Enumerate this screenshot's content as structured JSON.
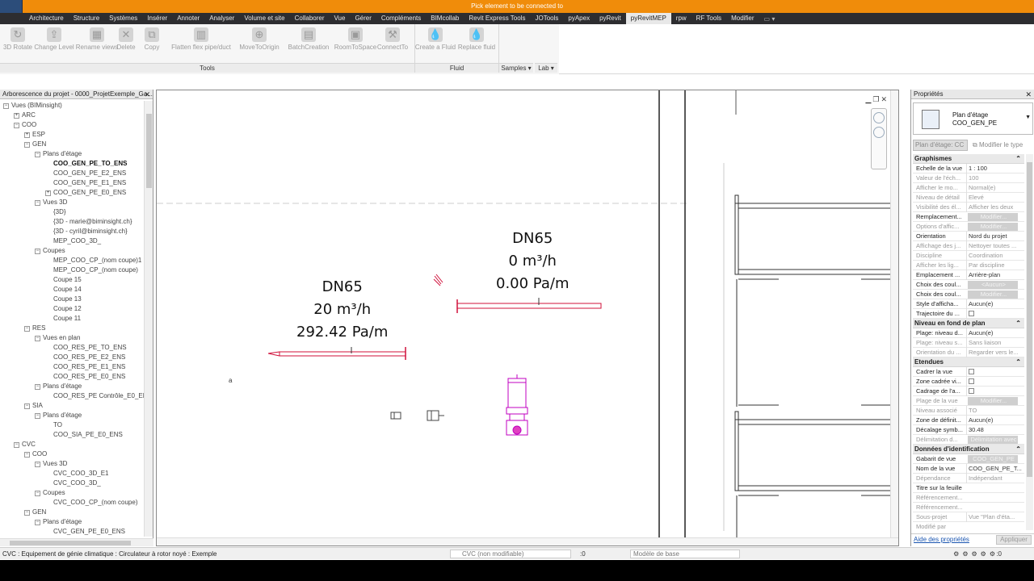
{
  "title": "Pick element to be connected to",
  "ribbon_tabs": [
    "Architecture",
    "Structure",
    "Systèmes",
    "Insérer",
    "Annoter",
    "Analyser",
    "Volume et site",
    "Collaborer",
    "Vue",
    "Gérer",
    "Compléments",
    "BIMcollab",
    "Revit Express Tools",
    "JOTools",
    "pyApex",
    "pyRevit",
    "pyRevitMEP",
    "rpw",
    "RF Tools",
    "Modifier"
  ],
  "active_tab": "pyRevitMEP",
  "ribbon_buttons": [
    {
      "label": "3D Rotate",
      "icon": "rotate-icon"
    },
    {
      "label": "Change Level",
      "icon": "level-icon"
    },
    {
      "label": "Rename views",
      "icon": "rename-icon"
    },
    {
      "label": "Delete",
      "icon": "delete-icon"
    },
    {
      "label": "Copy",
      "icon": "copy-icon"
    },
    {
      "label": "Flatten flex pipe/duct",
      "icon": "flatten-icon"
    },
    {
      "label": "MoveToOrigin",
      "icon": "target-icon"
    },
    {
      "label": "BatchCreation",
      "icon": "batch-icon"
    },
    {
      "label": "RoomToSpace",
      "icon": "room-icon"
    },
    {
      "label": "ConnectTo",
      "icon": "connect-icon"
    },
    {
      "label": "Create a Fluid",
      "icon": "drop-icon"
    },
    {
      "label": "Replace fluid",
      "icon": "drop-icon"
    }
  ],
  "ribbon_panels": {
    "tools": "Tools",
    "fluid": "Fluid",
    "samples": "Samples",
    "lab": "Lab"
  },
  "browser": {
    "title": "Arborescence du projet - 0000_ProjetExemple_Ga...",
    "nodes": [
      {
        "label": "Vues (BIMinsight)",
        "toggle": "−",
        "level": 0
      },
      {
        "label": "ARC",
        "toggle": "+",
        "level": 1
      },
      {
        "label": "COO",
        "toggle": "−",
        "level": 1
      },
      {
        "label": "ESP",
        "toggle": "+",
        "level": 2
      },
      {
        "label": "GEN",
        "toggle": "−",
        "level": 2
      },
      {
        "label": "Plans d'étage",
        "toggle": "−",
        "level": 3
      },
      {
        "label": "COO_GEN_PE_TO_ENS",
        "toggle": "",
        "level": 4,
        "bold": true
      },
      {
        "label": "COO_GEN_PE_E2_ENS",
        "toggle": "",
        "level": 4
      },
      {
        "label": "COO_GEN_PE_E1_ENS",
        "toggle": "",
        "level": 4
      },
      {
        "label": "COO_GEN_PE_E0_ENS",
        "toggle": "+",
        "level": 4
      },
      {
        "label": "Vues 3D",
        "toggle": "−",
        "level": 3
      },
      {
        "label": "{3D}",
        "toggle": "",
        "level": 4
      },
      {
        "label": "{3D - marie@biminsight.ch}",
        "toggle": "",
        "level": 4
      },
      {
        "label": "{3D - cyril@biminsight.ch}",
        "toggle": "",
        "level": 4
      },
      {
        "label": "MEP_COO_3D_",
        "toggle": "",
        "level": 4
      },
      {
        "label": "Coupes",
        "toggle": "−",
        "level": 3
      },
      {
        "label": "MEP_COO_CP_(nom coupe)1",
        "toggle": "",
        "level": 4
      },
      {
        "label": "MEP_COO_CP_(nom coupe)",
        "toggle": "",
        "level": 4
      },
      {
        "label": "Coupe 15",
        "toggle": "",
        "level": 4
      },
      {
        "label": "Coupe 14",
        "toggle": "",
        "level": 4
      },
      {
        "label": "Coupe 13",
        "toggle": "",
        "level": 4
      },
      {
        "label": "Coupe 12",
        "toggle": "",
        "level": 4
      },
      {
        "label": "Coupe 11",
        "toggle": "",
        "level": 4
      },
      {
        "label": "RES",
        "toggle": "−",
        "level": 2
      },
      {
        "label": "Vues en plan",
        "toggle": "−",
        "level": 3
      },
      {
        "label": "COO_RES_PE_TO_ENS",
        "toggle": "",
        "level": 4
      },
      {
        "label": "COO_RES_PE_E2_ENS",
        "toggle": "",
        "level": 4
      },
      {
        "label": "COO_RES_PE_E1_ENS",
        "toggle": "",
        "level": 4
      },
      {
        "label": "COO_RES_PE_E0_ENS",
        "toggle": "",
        "level": 4
      },
      {
        "label": "Plans d'étage",
        "toggle": "−",
        "level": 3
      },
      {
        "label": "COO_RES_PE Contrôle_E0_EN",
        "toggle": "",
        "level": 4
      },
      {
        "label": "SIA",
        "toggle": "−",
        "level": 2
      },
      {
        "label": "Plans d'étage",
        "toggle": "−",
        "level": 3
      },
      {
        "label": "TO",
        "toggle": "",
        "level": 4
      },
      {
        "label": "COO_SIA_PE_E0_ENS",
        "toggle": "",
        "level": 4
      },
      {
        "label": "CVC",
        "toggle": "−",
        "level": 1
      },
      {
        "label": "COO",
        "toggle": "−",
        "level": 2
      },
      {
        "label": "Vues 3D",
        "toggle": "−",
        "level": 3
      },
      {
        "label": "CVC_COO_3D_E1",
        "toggle": "",
        "level": 4
      },
      {
        "label": "CVC_COO_3D_",
        "toggle": "",
        "level": 4
      },
      {
        "label": "Coupes",
        "toggle": "−",
        "level": 3
      },
      {
        "label": "CVC_COO_CP_(nom coupe)",
        "toggle": "",
        "level": 4
      },
      {
        "label": "GEN",
        "toggle": "−",
        "level": 2
      },
      {
        "label": "Plans d'étage",
        "toggle": "−",
        "level": 3
      },
      {
        "label": "CVC_GEN_PE_E0_ENS",
        "toggle": "",
        "level": 4
      }
    ]
  },
  "canvas": {
    "pipe1": {
      "dn": "DN65",
      "flow": "20 m³/h",
      "loss": "292.42 Pa/m"
    },
    "pipe2": {
      "dn": "DN65",
      "flow": "0 m³/h",
      "loss": "0.00 Pa/m"
    },
    "small_mark": "a",
    "pipe_color": "#d0103a",
    "equipment_color": "#c000c0"
  },
  "properties": {
    "title": "Propriétés",
    "type_line1": "Plan d'étage",
    "type_line2": "COO_GEN_PE",
    "instance_field": "Plan d'étage: CC",
    "edit_type": "Modifier le type",
    "sections": [
      {
        "name": "Graphismes",
        "rows": [
          {
            "k": "Echelle de la vue",
            "v": "1 : 100"
          },
          {
            "k": "Valeur de l'éch...",
            "v": "100",
            "dim": true
          },
          {
            "k": "Afficher le mo...",
            "v": "Normal(e)",
            "dim": true
          },
          {
            "k": "Niveau de détail",
            "v": "Elevé",
            "dim": true
          },
          {
            "k": "Visibilité des él...",
            "v": "Afficher les deux",
            "dim": true
          },
          {
            "k": "Remplacement...",
            "v": "Modifier...",
            "btn": true
          },
          {
            "k": "Options d'affic...",
            "v": "Modifier...",
            "btn": true,
            "dim": true
          },
          {
            "k": "Orientation",
            "v": "Nord du projet"
          },
          {
            "k": "Affichage des j...",
            "v": "Nettoyer toutes ...",
            "dim": true
          },
          {
            "k": "Discipline",
            "v": "Coordination",
            "dim": true
          },
          {
            "k": "Afficher les lig...",
            "v": "Par discipline",
            "dim": true
          },
          {
            "k": "Emplacement ...",
            "v": "Arrière-plan"
          },
          {
            "k": "Choix des coul...",
            "v": "<Aucun>",
            "btn": true
          },
          {
            "k": "Choix des coul...",
            "v": "Modifier...",
            "btn": true
          },
          {
            "k": "Style d'afficha...",
            "v": "Aucun(e)"
          },
          {
            "k": "Trajectoire du ...",
            "v": "",
            "chk": true
          }
        ]
      },
      {
        "name": "Niveau en fond de plan",
        "rows": [
          {
            "k": "Plage: niveau d...",
            "v": "Aucun(e)"
          },
          {
            "k": "Plage: niveau s...",
            "v": "Sans liaison",
            "dim": true
          },
          {
            "k": "Orientation du ...",
            "v": "Regarder vers le...",
            "dim": true
          }
        ]
      },
      {
        "name": "Etendues",
        "rows": [
          {
            "k": "Cadrer la vue",
            "v": "",
            "chk": true
          },
          {
            "k": "Zone cadrée vi...",
            "v": "",
            "chk": true
          },
          {
            "k": "Cadrage de l'a...",
            "v": "",
            "chk": true
          },
          {
            "k": "Plage de la vue",
            "v": "Modifier...",
            "btn": true,
            "dim": true
          },
          {
            "k": "Niveau associé",
            "v": "TO",
            "dim": true
          },
          {
            "k": "Zone de définit...",
            "v": "Aucun(e)"
          },
          {
            "k": "Décalage symb...",
            "v": "30.48"
          },
          {
            "k": "Délimitation d...",
            "v": "Délimitation avec",
            "btn": true,
            "dim": true
          }
        ]
      },
      {
        "name": "Données d'identification",
        "rows": [
          {
            "k": "Gabarit de vue",
            "v": "COO_GEN_PE",
            "btn": true
          },
          {
            "k": "Nom de la vue",
            "v": "COO_GEN_PE_T..."
          },
          {
            "k": "Dépendance",
            "v": "Indépendant",
            "dim": true
          },
          {
            "k": "Titre sur la feuille",
            "v": ""
          },
          {
            "k": "Référencement...",
            "v": "",
            "dim": true
          },
          {
            "k": "Référencement...",
            "v": "",
            "dim": true
          },
          {
            "k": "Sous-projet",
            "v": "Vue \"Plan d'éta...",
            "dim": true
          },
          {
            "k": "Modifié par",
            "v": "",
            "dim": true
          }
        ]
      }
    ],
    "help": "Aide des propriétés",
    "apply": "Appliquer"
  },
  "status": {
    "message": "CVC : Equipement de génie climatique : Circulateur à rotor noyé : Exemple",
    "workset": "CVC (non modifiable)",
    "count": ":0",
    "model": "Modèle de base",
    "filter_count": ":0"
  }
}
